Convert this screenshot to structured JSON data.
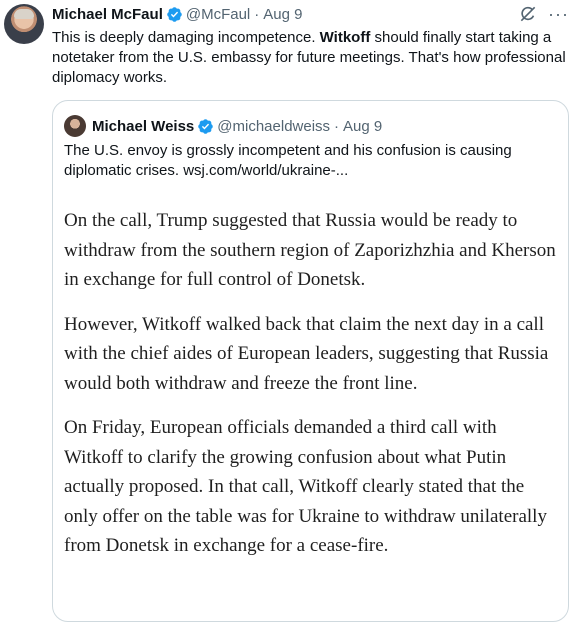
{
  "tweet": {
    "author_name": "Michael McFaul",
    "handle": "@McFaul",
    "separator": "·",
    "date": "Aug 9",
    "more_label": "···",
    "text_before": "This is deeply damaging incompetence. ",
    "text_bold": "Witkoff",
    "text_after": " should finally start taking a notetaker from the U.S. embassy for future meetings. That's how professional diplomacy works."
  },
  "quote": {
    "author_name": "Michael Weiss",
    "handle": "@michaeldweiss",
    "separator": "·",
    "date": "Aug 9",
    "text": "The U.S. envoy is grossly incompetent and his confusion is causing diplomatic crises. wsj.com/world/ukraine-...",
    "paragraphs": [
      "On the call, Trump suggested that Russia would be ready to withdraw from the southern region of Zaporizhzhia and Kherson in exchange for full control of Donetsk.",
      "However, Witkoff walked back that claim the next day in a call with the chief aides of European leaders, suggesting that Russia would both withdraw and freeze the front line.",
      "On Friday, European officials demanded a third call with Witkoff to clarify the growing confusion about what Putin actually proposed. In that call, Witkoff clearly stated that the only offer on the table was for Ukraine to withdraw unilaterally from Donetsk in exchange for a cease-fire."
    ]
  },
  "colors": {
    "verified": "#1d9bf0",
    "muted": "#536471",
    "border": "#cfd9de"
  },
  "icons": {
    "verified": "verified-badge-icon",
    "grok": "grok-icon",
    "more": "more-icon"
  }
}
